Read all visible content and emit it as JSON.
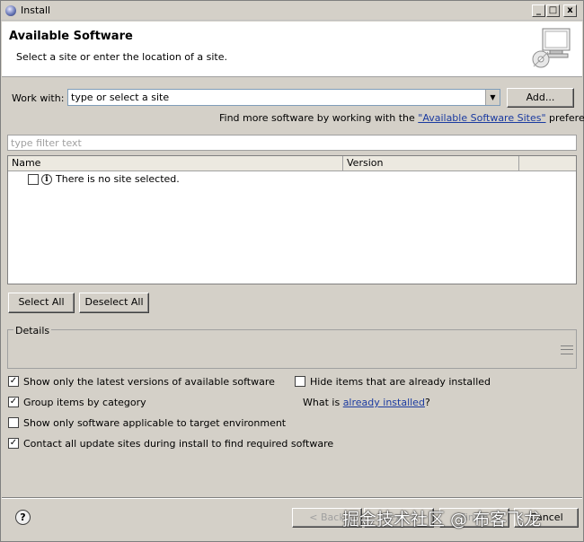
{
  "window": {
    "title": "Install",
    "controls": {
      "minimize": "_",
      "maximize": "□",
      "close": "x"
    }
  },
  "header": {
    "title": "Available Software",
    "description": "Select a site or enter the location of a site."
  },
  "work_with": {
    "label": "Work with:",
    "value": "type or select a site",
    "add_label": "Add..."
  },
  "find_more": {
    "prefix": "Find more software by working with the ",
    "link": "\"Available Software Sites\"",
    "suffix": " preferences."
  },
  "filter": {
    "placeholder": "type filter text"
  },
  "table": {
    "columns": [
      "Name",
      "Version"
    ],
    "rows": [
      {
        "name": "There is no site selected."
      }
    ]
  },
  "selection": {
    "select_all": "Select All",
    "deselect_all": "Deselect All"
  },
  "details": {
    "label": "Details"
  },
  "options": {
    "latest_versions": {
      "label": "Show only the latest versions of available software",
      "checked": true
    },
    "group_by_category": {
      "label": "Group items by category",
      "checked": true
    },
    "target_env": {
      "label": "Show only software applicable to target environment",
      "checked": false
    },
    "contact_sites": {
      "label": "Contact all update sites during install to find required software",
      "checked": true
    },
    "hide_installed": {
      "label": "Hide items that are already installed",
      "checked": false
    },
    "what_is": {
      "prefix": "What is ",
      "link": "already installed",
      "suffix": "?"
    }
  },
  "footer": {
    "help": "?",
    "back": "< Back",
    "next": "Next >",
    "finish": "Finish",
    "cancel": "Cancel"
  },
  "watermark": "掘金技术社区 @ 布客飞龙",
  "colors": {
    "link": "#1a3aa0",
    "face": "#d4d0c8"
  }
}
